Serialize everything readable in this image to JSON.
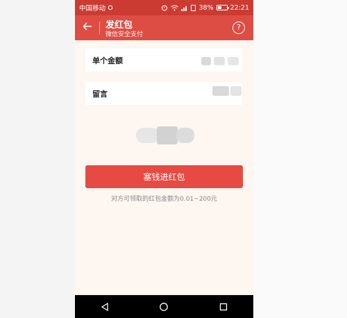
{
  "status_bar": {
    "carrier": "中国移动",
    "battery": "38%",
    "time": "22:21"
  },
  "header": {
    "title": "发红包",
    "subtitle": "微信安全支付",
    "help_glyph": "?"
  },
  "form": {
    "amount_label": "单个金额",
    "message_label": "留言"
  },
  "submit_label": "塞钱进红包",
  "hint": "对方可领取的红包金额为0.01~200元",
  "colors": {
    "accent": "#dd4d44",
    "status": "#cc3b32",
    "button": "#e64a43",
    "background": "#fdf6f1"
  }
}
